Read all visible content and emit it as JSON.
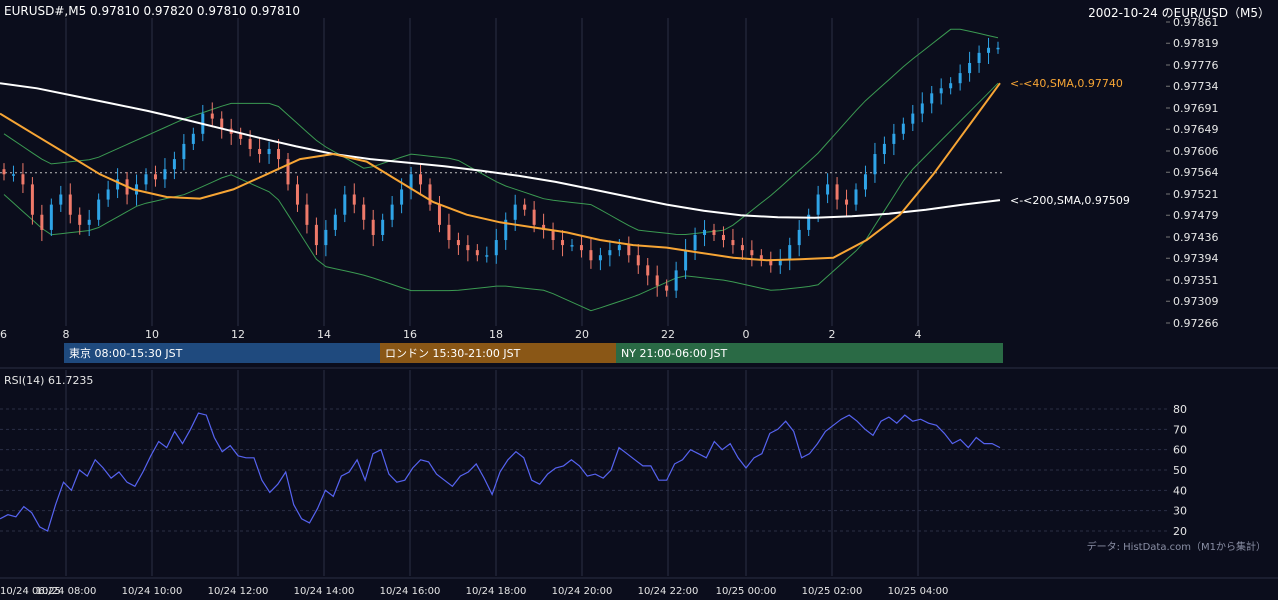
{
  "header": {
    "symbol_ohlc": "EURUSD#,M5 0.97810 0.97820 0.97810 0.97810",
    "title_right": "2002-10-24 のEUR/USD（M5）"
  },
  "price_axis": {
    "ticks": [
      "0.97861",
      "0.97819",
      "0.97776",
      "0.97734",
      "0.97691",
      "0.97649",
      "0.97606",
      "0.97564",
      "0.97521",
      "0.97479",
      "0.97436",
      "0.97394",
      "0.97351",
      "0.97309",
      "0.97266"
    ],
    "min": 0.97266,
    "max": 0.97861
  },
  "hour_axis": {
    "labels": [
      "6",
      "8",
      "10",
      "12",
      "14",
      "16",
      "18",
      "20",
      "22",
      "0",
      "2",
      "4"
    ]
  },
  "sessions": [
    {
      "label": "東京 08:00-15:30 JST",
      "color": "#1f4a7e"
    },
    {
      "label": "ロンドン 15:30-21:00 JST",
      "color": "#8a5716"
    },
    {
      "label": "NY 21:00-06:00 JST",
      "color": "#2a6a45"
    }
  ],
  "indicators": {
    "sma40_label": "<-<40,SMA,0.97740",
    "sma200_label": "<-<200,SMA,0.97509",
    "sma40_color": "#f7a535",
    "sma200_color": "#ffffff",
    "bb_color": "#3b9a52",
    "bull_color": "#2fa4e7",
    "bear_color": "#ef7a6a"
  },
  "rsi": {
    "label": "RSI(14) 61.7235",
    "ticks": [
      "80",
      "70",
      "60",
      "50",
      "40",
      "30",
      "20"
    ],
    "min": 20,
    "max": 80,
    "color": "#5663f0"
  },
  "time_axis": {
    "labels": [
      "10/24 06:25",
      "10/24 08:00",
      "10/24 10:00",
      "10/24 12:00",
      "10/24 14:00",
      "10/24 16:00",
      "10/24 18:00",
      "10/24 20:00",
      "10/24 22:00",
      "10/25 00:00",
      "10/25 02:00",
      "10/25 04:00"
    ]
  },
  "footer": {
    "source": "データ: HistData.com（M1から集計）"
  },
  "chart_data": [
    {
      "type": "candlestick",
      "title": "2002-10-24 のEUR/USD（M5）",
      "ylim": [
        0.97266,
        0.97861
      ],
      "current_price": 0.9781,
      "series": [
        {
          "name": "SMA40",
          "last": 0.9774,
          "values": [
            0.9768,
            0.9764,
            0.976,
            0.9756,
            0.9753,
            0.97515,
            0.97512,
            0.9753,
            0.9756,
            0.9759,
            0.976,
            0.97585,
            0.97545,
            0.97505,
            0.9748,
            0.97465,
            0.97455,
            0.97445,
            0.9743,
            0.9742,
            0.97415,
            0.97405,
            0.97395,
            0.9739,
            0.97392,
            0.97395,
            0.9743,
            0.9748,
            0.9756,
            0.9765,
            0.9774
          ]
        },
        {
          "name": "SMA200",
          "last": 0.97509,
          "values": [
            0.9774,
            0.9773,
            0.97715,
            0.977,
            0.97685,
            0.97668,
            0.9765,
            0.97632,
            0.97615,
            0.976,
            0.9759,
            0.97583,
            0.97576,
            0.97567,
            0.97557,
            0.97545,
            0.9753,
            0.97515,
            0.975,
            0.97488,
            0.97479,
            0.97475,
            0.97474,
            0.97477,
            0.97482,
            0.9749,
            0.975,
            0.97509
          ]
        }
      ],
      "bollinger_upper": [
        0.9764,
        0.9758,
        0.9759,
        0.9763,
        0.9767,
        0.977,
        0.977,
        0.9762,
        0.9757,
        0.976,
        0.9759,
        0.9754,
        0.9751,
        0.975,
        0.9745,
        0.9744,
        0.9745,
        0.9752,
        0.976,
        0.977,
        0.9778,
        0.9785,
        0.9783
      ],
      "bollinger_lower": [
        0.9752,
        0.9744,
        0.9745,
        0.975,
        0.9752,
        0.9756,
        0.9752,
        0.9738,
        0.9736,
        0.9733,
        0.9733,
        0.9734,
        0.9733,
        0.9729,
        0.9732,
        0.9736,
        0.9735,
        0.9733,
        0.9734,
        0.9742,
        0.9756,
        0.9765,
        0.9774
      ],
      "close": [
        0.9756,
        0.9756,
        0.9754,
        0.9748,
        0.9745,
        0.975,
        0.9752,
        0.9748,
        0.9746,
        0.9747,
        0.9751,
        0.9753,
        0.9755,
        0.9752,
        0.9754,
        0.9756,
        0.9755,
        0.9757,
        0.9759,
        0.9762,
        0.9764,
        0.9768,
        0.9767,
        0.9765,
        0.9764,
        0.9763,
        0.9761,
        0.976,
        0.9761,
        0.9759,
        0.9754,
        0.975,
        0.9746,
        0.9742,
        0.9745,
        0.9748,
        0.9752,
        0.975,
        0.9747,
        0.9744,
        0.9747,
        0.975,
        0.9753,
        0.9756,
        0.9754,
        0.975,
        0.9746,
        0.9743,
        0.9742,
        0.9741,
        0.974,
        0.974,
        0.9743,
        0.9747,
        0.975,
        0.9749,
        0.9746,
        0.9745,
        0.9743,
        0.9742,
        0.9742,
        0.9741,
        0.9739,
        0.974,
        0.9741,
        0.9742,
        0.974,
        0.9738,
        0.9736,
        0.9734,
        0.9733,
        0.9737,
        0.9741,
        0.9744,
        0.9745,
        0.9744,
        0.9743,
        0.9742,
        0.9741,
        0.974,
        0.9739,
        0.9738,
        0.9739,
        0.9742,
        0.9745,
        0.9748,
        0.9752,
        0.9754,
        0.9751,
        0.975,
        0.9753,
        0.9756,
        0.976,
        0.9762,
        0.9764,
        0.9766,
        0.9768,
        0.977,
        0.9772,
        0.9773,
        0.9774,
        0.9776,
        0.9778,
        0.978,
        0.9781,
        0.9781
      ]
    },
    {
      "type": "line",
      "title": "RSI(14) 61.7235",
      "ylim": [
        20,
        80
      ],
      "series": [
        {
          "name": "RSI(14)",
          "values": [
            26,
            28,
            27,
            32,
            29,
            22,
            20,
            33,
            44,
            40,
            50,
            47,
            55,
            51,
            46,
            49,
            44,
            42,
            49,
            57,
            64,
            61,
            69,
            63,
            70,
            78,
            77,
            66,
            59,
            62,
            57,
            56,
            56,
            45,
            39,
            43,
            49,
            33,
            26,
            24,
            31,
            40,
            37,
            47,
            49,
            55,
            45,
            58,
            60,
            48,
            44,
            45,
            51,
            55,
            54,
            48,
            45,
            42,
            47,
            49,
            53,
            46,
            38,
            49,
            55,
            59,
            56,
            45,
            43,
            48,
            51,
            52,
            55,
            52,
            47,
            48,
            46,
            50,
            61,
            58,
            55,
            52,
            52,
            45,
            45,
            53,
            55,
            60,
            58,
            56,
            64,
            60,
            63,
            56,
            51,
            56,
            58,
            68,
            70,
            74,
            69,
            56,
            58,
            63,
            69,
            72,
            75,
            77,
            74,
            70,
            67,
            74,
            76,
            73,
            77,
            74,
            75,
            73,
            72,
            68,
            63,
            65,
            61,
            66,
            63,
            63,
            61
          ]
        }
      ]
    }
  ]
}
